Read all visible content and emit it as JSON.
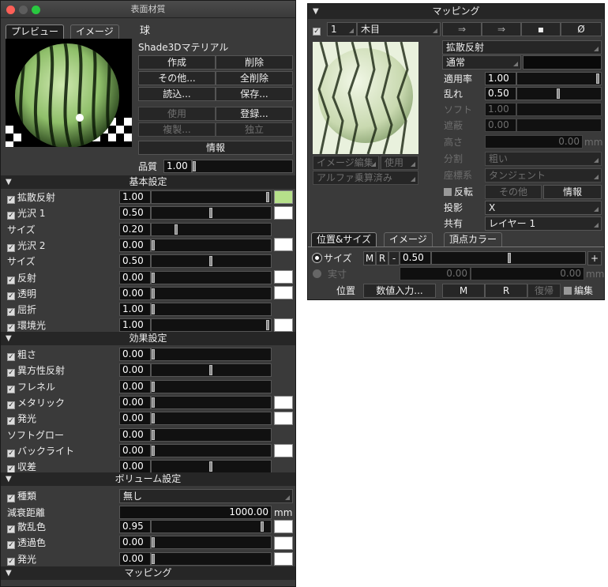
{
  "left": {
    "title": "表面材質",
    "tabs": {
      "preview": "プレビュー",
      "image": "イメージ"
    },
    "object": "球",
    "material": "Shade3Dマテリアル",
    "buttons": {
      "create": "作成",
      "delete": "削除",
      "other": "その他...",
      "delete_all": "全削除",
      "load": "読込...",
      "save": "保存...",
      "use": "使用",
      "register": "登録...",
      "duplicate": "複製...",
      "independent": "独立",
      "info": "情報"
    },
    "quality": {
      "label": "品質",
      "value": "1.00"
    },
    "basic": {
      "header": "基本設定",
      "rows": [
        {
          "label": "拡散反射",
          "value": "1.00",
          "check": true,
          "thumb": 1.0
        },
        {
          "label": "光沢 1",
          "value": "0.50",
          "check": true,
          "thumb": 0.5
        },
        {
          "label": "サイズ",
          "value": "0.20",
          "check": false,
          "thumb": 0.2
        },
        {
          "label": "光沢 2",
          "value": "0.00",
          "check": true,
          "thumb": 0
        },
        {
          "label": "サイズ",
          "value": "0.50",
          "check": false,
          "thumb": 0.5
        },
        {
          "label": "反射",
          "value": "0.00",
          "check": true,
          "thumb": 0
        },
        {
          "label": "透明",
          "value": "0.00",
          "check": true,
          "thumb": 0
        },
        {
          "label": "屈折",
          "value": "1.00",
          "check": true,
          "thumb": 0
        },
        {
          "label": "環境光",
          "value": "1.00",
          "check": true,
          "thumb": 1.0
        }
      ]
    },
    "effect": {
      "header": "効果設定",
      "rows": [
        {
          "label": "粗さ",
          "value": "0.00",
          "check": true,
          "thumb": 0
        },
        {
          "label": "異方性反射",
          "value": "0.00",
          "check": true,
          "thumb": 0.5
        },
        {
          "label": "フレネル",
          "value": "0.00",
          "check": true,
          "thumb": 0
        },
        {
          "label": "メタリック",
          "value": "0.00",
          "check": true,
          "thumb": 0
        },
        {
          "label": "発光",
          "value": "0.00",
          "check": true,
          "thumb": 0
        },
        {
          "label": "ソフトグロー",
          "value": "0.00",
          "check": false,
          "thumb": 0
        },
        {
          "label": "バックライト",
          "value": "0.00",
          "check": true,
          "thumb": 0
        },
        {
          "label": "収差",
          "value": "0.00",
          "check": true,
          "thumb": 0.5
        }
      ]
    },
    "volume": {
      "header": "ボリューム設定",
      "type_label": "種類",
      "type_value": "無し",
      "attenuation_label": "減衰距離",
      "attenuation_value": "1000.00",
      "unit": "mm",
      "rows": [
        {
          "label": "散乱色",
          "value": "0.95",
          "check": true,
          "thumb": 0.95
        },
        {
          "label": "透過色",
          "value": "0.00",
          "check": true,
          "thumb": 0
        },
        {
          "label": "発光",
          "value": "0.00",
          "check": true,
          "thumb": 0
        }
      ]
    },
    "mapping_header": "マッピング"
  },
  "right": {
    "header": "マッピング",
    "layer_num": "1",
    "layer_type": "木目",
    "icons": {
      "a": "⇒",
      "b": "⇒",
      "c": "▪",
      "d": "Ø"
    },
    "diffuse": "拡散反射",
    "normal": "通常",
    "apply_rate": {
      "label": "適用率",
      "value": "1.00",
      "thumb": 1.0
    },
    "turbulence": {
      "label": "乱れ",
      "value": "0.50",
      "thumb": 0.5
    },
    "soft": {
      "label": "ソフト",
      "value": "1.00"
    },
    "shield": {
      "label": "遮蔽",
      "value": "0.00"
    },
    "height": {
      "label": "高さ",
      "value": "0.00",
      "unit": "mm"
    },
    "division": {
      "label": "分割",
      "value": "粗い"
    },
    "coord": {
      "label": "座標系",
      "value": "タンジェント"
    },
    "image_edit": "イメージ編集",
    "use": "使用",
    "alpha": "アルファ乗算済み",
    "invert": "反転",
    "other": "その他",
    "info": "情報",
    "projection": {
      "label": "投影",
      "value": "X"
    },
    "share": {
      "label": "共有",
      "value": "レイヤー 1"
    },
    "tabs": {
      "pos": "位置&サイズ",
      "image": "イメージ",
      "vertex": "頂点カラー"
    },
    "size": {
      "label": "サイズ",
      "m": "M",
      "r": "R",
      "minus": "-",
      "value": "0.50",
      "plus": "+"
    },
    "real": {
      "label": "実寸",
      "v1": "0.00",
      "v2": "0.00",
      "unit": "mm"
    },
    "pos": {
      "label": "位置",
      "numeric": "数値入力...",
      "m": "M",
      "r": "R",
      "restore": "復帰",
      "edit": "編集"
    }
  }
}
